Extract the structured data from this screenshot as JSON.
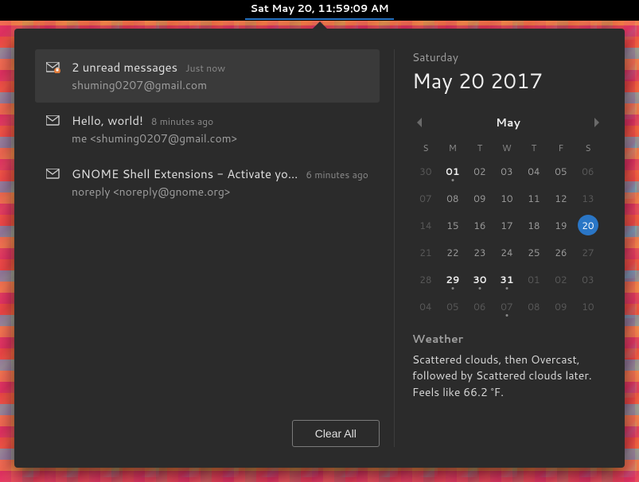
{
  "topbar": {
    "clock": "Sat May 20, 11:59:09 AM"
  },
  "date": {
    "weekday": "Saturday",
    "full": "May 20 2017"
  },
  "notifications": {
    "items": [
      {
        "title": "2 unread messages",
        "time": "Just now",
        "sub": "shuming0207@gmail.com",
        "icon": "mail-unread",
        "selected": true
      },
      {
        "title": "Hello, world!",
        "time": "8 minutes ago",
        "sub": "me <shuming0207@gmail.com>",
        "icon": "mail",
        "selected": false
      },
      {
        "title": "GNOME Shell Extensions - Activate yo…",
        "time": "6 minutes ago",
        "sub": "noreply <noreply@gnome.org>",
        "icon": "mail",
        "selected": false
      }
    ],
    "clear_label": "Clear All"
  },
  "calendar": {
    "month_label": "May",
    "dow": [
      "S",
      "M",
      "T",
      "W",
      "T",
      "F",
      "S"
    ],
    "weeks": [
      [
        {
          "d": "30",
          "other": true
        },
        {
          "d": "01",
          "bold": true,
          "dot": true
        },
        {
          "d": "02"
        },
        {
          "d": "03"
        },
        {
          "d": "04"
        },
        {
          "d": "05"
        },
        {
          "d": "06",
          "other": true
        }
      ],
      [
        {
          "d": "07",
          "other": true
        },
        {
          "d": "08"
        },
        {
          "d": "09"
        },
        {
          "d": "10"
        },
        {
          "d": "11"
        },
        {
          "d": "12"
        },
        {
          "d": "13",
          "other": true
        }
      ],
      [
        {
          "d": "14",
          "other": true
        },
        {
          "d": "15"
        },
        {
          "d": "16"
        },
        {
          "d": "17"
        },
        {
          "d": "18"
        },
        {
          "d": "19"
        },
        {
          "d": "20",
          "today": true
        }
      ],
      [
        {
          "d": "21",
          "other": true
        },
        {
          "d": "22"
        },
        {
          "d": "23"
        },
        {
          "d": "24"
        },
        {
          "d": "25"
        },
        {
          "d": "26"
        },
        {
          "d": "27",
          "other": true
        }
      ],
      [
        {
          "d": "28",
          "other": true
        },
        {
          "d": "29",
          "bold": true,
          "dot": true
        },
        {
          "d": "30",
          "bold": true,
          "dot": true
        },
        {
          "d": "31",
          "bold": true,
          "dot": true
        },
        {
          "d": "01",
          "other": true
        },
        {
          "d": "02",
          "other": true
        },
        {
          "d": "03",
          "other": true
        }
      ],
      [
        {
          "d": "04",
          "other": true
        },
        {
          "d": "05",
          "other": true
        },
        {
          "d": "06",
          "other": true
        },
        {
          "d": "07",
          "other": true,
          "dot": true
        },
        {
          "d": "08",
          "other": true
        },
        {
          "d": "09",
          "other": true
        },
        {
          "d": "10",
          "other": true
        }
      ]
    ]
  },
  "weather": {
    "heading": "Weather",
    "text": "Scattered clouds, then Overcast, followed by Scattered clouds later. Feels like 66.2 °F."
  }
}
